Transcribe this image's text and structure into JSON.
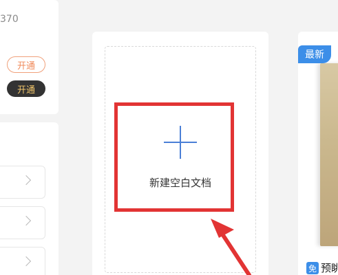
{
  "left_panel": {
    "number_fragment": "370",
    "open_label": "开通",
    "open_dark_label": "开通"
  },
  "main": {
    "new_blank_doc_label": "新建空白文档"
  },
  "right_panel": {
    "badge_new": "最新",
    "free_badge": "免",
    "item_title_fragment": "预眺"
  },
  "colors": {
    "accent_blue": "#3c8ee8",
    "plus_blue": "#4a7fd6",
    "highlight_red": "#e23434",
    "pill_orange": "#f08a5a",
    "dark_pill_bg": "#333333",
    "dark_pill_text": "#f2c66b"
  },
  "icons": {
    "plus": "plus-icon",
    "chevron": "chevron-right-icon",
    "arrow": "annotation-arrow"
  }
}
